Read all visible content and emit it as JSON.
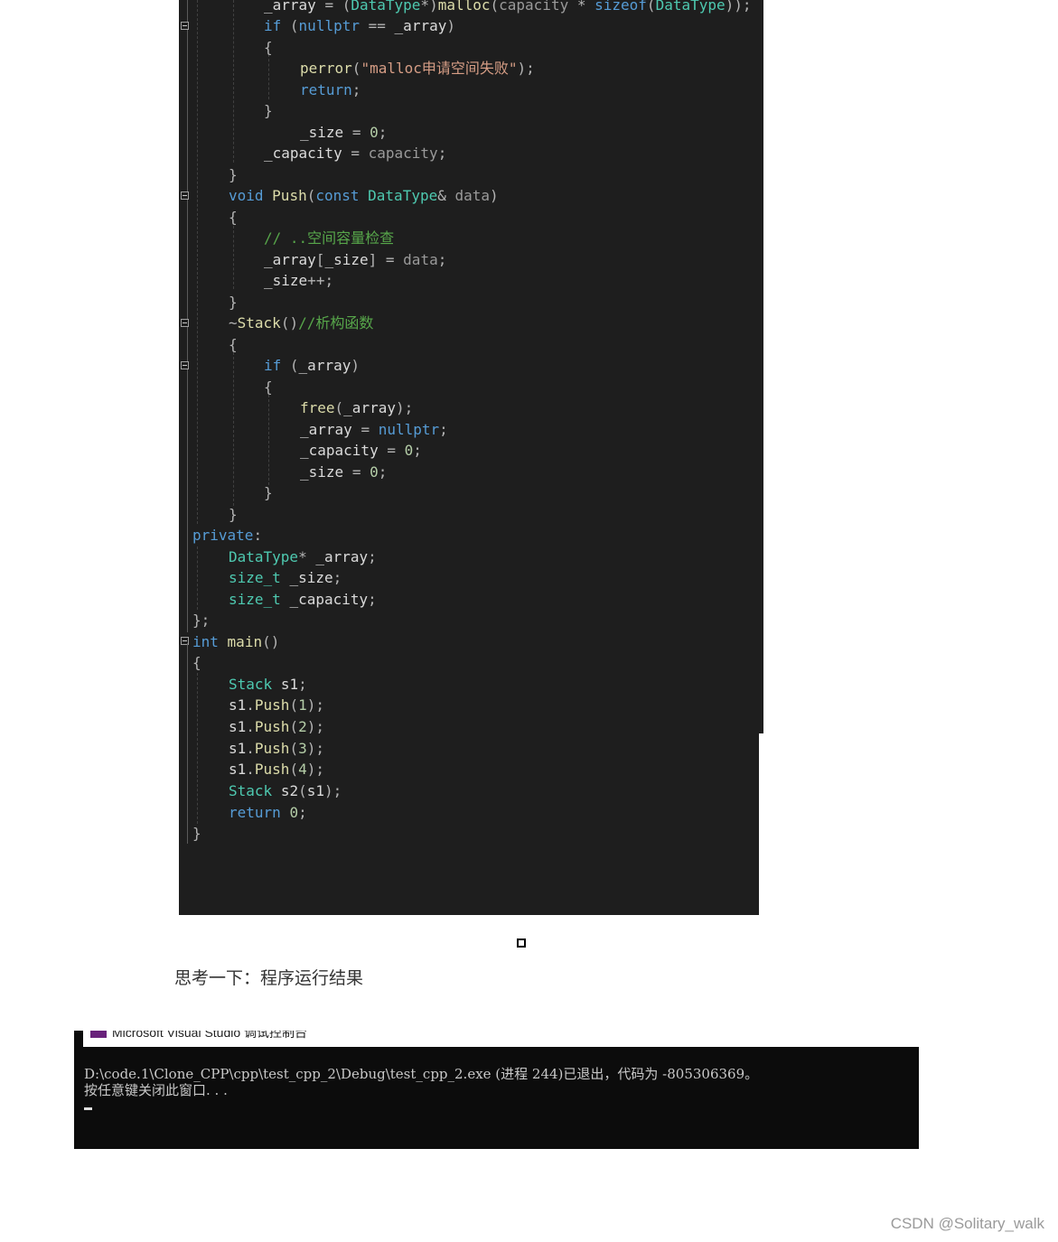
{
  "editor": {
    "lines": [
      {
        "text": "_array = (DataType*)malloc(capacity * sizeof(DataType));"
      },
      {
        "text": "if (nullptr == _array)"
      },
      {
        "text": "{"
      },
      {
        "text": "perror(\"malloc申请空间失败\");"
      },
      {
        "text": "return;"
      },
      {
        "text": "}"
      },
      {
        "text": "_size = 0;"
      },
      {
        "text": "_capacity = capacity;"
      },
      {
        "text": "}"
      },
      {
        "text": "void Push(const DataType& data)"
      },
      {
        "text": "{"
      },
      {
        "text": "// ..空间容量检查"
      },
      {
        "text": "_array[_size] = data;"
      },
      {
        "text": "_size++;"
      },
      {
        "text": "}"
      },
      {
        "text": "~Stack()//析构函数"
      },
      {
        "text": "{"
      },
      {
        "text": "if (_array)"
      },
      {
        "text": "{"
      },
      {
        "text": "free(_array);"
      },
      {
        "text": "_array = nullptr;"
      },
      {
        "text": "_capacity = 0;"
      },
      {
        "text": "_size = 0;"
      },
      {
        "text": "}"
      },
      {
        "text": "}"
      },
      {
        "text": "private:"
      },
      {
        "text": "DataType* _array;"
      },
      {
        "text": "size_t _size;"
      },
      {
        "text": "size_t _capacity;"
      },
      {
        "text": "};"
      },
      {
        "text": "int main()"
      },
      {
        "text": "{"
      },
      {
        "text": "Stack s1;"
      },
      {
        "text": "s1.Push(1);"
      },
      {
        "text": "s1.Push(2);"
      },
      {
        "text": "s1.Push(3);"
      },
      {
        "text": "s1.Push(4);"
      },
      {
        "text": "Stack s2(s1);"
      },
      {
        "text": "return 0;"
      },
      {
        "text": "}"
      }
    ]
  },
  "question": "思考一下：程序运行结果",
  "console": {
    "title": "Microsoft Visual Studio 调试控制台",
    "line1": "D:\\code.1\\Clone_CPP\\cpp\\test_cpp_2\\Debug\\test_cpp_2.exe (进程 244)已退出，代码为 -805306369。",
    "line2": "按任意键关闭此窗口. . ."
  },
  "watermark": "CSDN @Solitary_walk",
  "colors": {
    "editor_bg": "#1e1e1e",
    "keyword": "#569cd6",
    "type": "#4ec9b0",
    "function": "#dcdcaa",
    "string": "#d69d85",
    "number": "#b5cea8",
    "comment": "#57a64a",
    "console_bg": "#0c0c0c"
  }
}
